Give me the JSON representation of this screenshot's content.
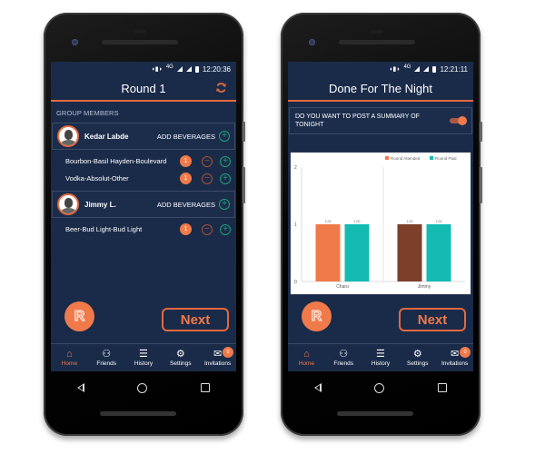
{
  "left_phone": {
    "status_bar": {
      "network": "4G",
      "time": "12:20:36"
    },
    "title": "Round 1",
    "refresh_icon": "refresh-icon",
    "section_label": "GROUP MEMBERS",
    "members": [
      {
        "name": "Kedar Labde",
        "add_label": "ADD BEVERAGES",
        "beverages": [
          {
            "name": "Bourbon-Basil Hayden-Boulevard",
            "count": "1"
          },
          {
            "name": "Vodka-Absolut-Other",
            "count": "1"
          }
        ]
      },
      {
        "name": "Jimmy  L.",
        "add_label": "ADD BEVERAGES",
        "beverages": [
          {
            "name": "Beer-Bud Light-Bud Light",
            "count": "1"
          }
        ]
      }
    ],
    "fab_label": "R",
    "next_label": "Next"
  },
  "right_phone": {
    "status_bar": {
      "network": "4G",
      "time": "12:21:11"
    },
    "title": "Done For The Night",
    "post_question": "DO YOU WANT TO POST A SUMMARY OF TONIGHT",
    "post_toggle_on": true,
    "fab_label": "R",
    "next_label": "Next"
  },
  "bottom_nav": {
    "items": [
      {
        "label": "Home",
        "icon": "home-icon",
        "active": true
      },
      {
        "label": "Friends",
        "icon": "friends-icon",
        "active": false
      },
      {
        "label": "History",
        "icon": "history-list-icon",
        "active": false
      },
      {
        "label": "Settings",
        "icon": "gear-icon",
        "active": false
      },
      {
        "label": "Invitations",
        "icon": "invitations-icon",
        "active": false,
        "badge": "0"
      }
    ]
  },
  "colors": {
    "background": "#1a2b49",
    "accent": "#f07a4a",
    "green": "#1ea07a",
    "teal": "#13bbb2",
    "brown": "#7e3f2a"
  },
  "chart_data": {
    "type": "bar",
    "categories": [
      "Charu",
      "Jimmy"
    ],
    "series": [
      {
        "name": "Round Attended",
        "values": [
          1,
          1
        ],
        "colors": [
          "#f07a4a",
          "#7e3f2a"
        ]
      },
      {
        "name": "Round Paid",
        "values": [
          1,
          1
        ],
        "colors": [
          "#13bbb2",
          "#13bbb2"
        ]
      }
    ],
    "data_labels": [
      "1.00",
      "1.00",
      "1.00",
      "1.00"
    ],
    "yticks": [
      0,
      1,
      2
    ],
    "ylim": [
      0,
      2
    ],
    "legend": "top-right",
    "grid": false,
    "title": "",
    "xlabel": "",
    "ylabel": ""
  }
}
